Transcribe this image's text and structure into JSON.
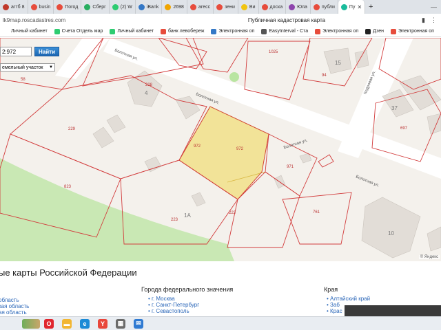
{
  "browser": {
    "tabs": [
      {
        "label": "агтб 8",
        "color": "#c0392b"
      },
      {
        "label": "busin",
        "color": "#e74c3c"
      },
      {
        "label": "Погод",
        "color": "#e74c3c"
      },
      {
        "label": "Сберг",
        "color": "#27ae60"
      },
      {
        "label": "(2) W",
        "color": "#2ecc71"
      },
      {
        "label": "iBank",
        "color": "#3478c6"
      },
      {
        "label": "2698",
        "color": "#f0a500"
      },
      {
        "label": "агесс",
        "color": "#e74c3c"
      },
      {
        "label": "зени",
        "color": "#e74c3c"
      },
      {
        "label": "Ви",
        "color": "#f1c40f"
      },
      {
        "label": "доска",
        "color": "#e74c3c"
      },
      {
        "label": "Юла",
        "color": "#8e44ad"
      },
      {
        "label": "публи",
        "color": "#e74c3c"
      },
      {
        "label": "Пу",
        "color": "#1abc9c",
        "active": true
      }
    ],
    "new_tab": "+",
    "url": "lk9map.roscadastres.com",
    "page_title": "Публичная кадастровая карта",
    "bookmarks": [
      {
        "label": "Личный кабинет",
        "color": "#ffffff"
      },
      {
        "label": "Счета Отдель мар",
        "color": "#2ecc71"
      },
      {
        "label": "Личный кабинет",
        "color": "#2ecc71"
      },
      {
        "label": "банк левобереж",
        "color": "#e74c3c"
      },
      {
        "label": "Электронная оп",
        "color": "#3478c6"
      },
      {
        "label": "EasyInterval - Ста",
        "color": "#555555"
      },
      {
        "label": "Электронная оп",
        "color": "#e74c3c"
      },
      {
        "label": "Дзен",
        "color": "#222222"
      },
      {
        "label": "Электронная оп",
        "color": "#e74c3c"
      }
    ]
  },
  "map": {
    "search_value": "2:972",
    "search_button": "Найти",
    "type_select": "емельный участок",
    "credit": "© Яндекс",
    "labels": {
      "parcel_main_a": "972",
      "parcel_main_b": "972",
      "p971": "971",
      "p229": "229",
      "p823": "823",
      "p223_a": "223",
      "p223_b": "223",
      "p761": "761",
      "p1025": "1025",
      "p94": "94",
      "p58": "58",
      "p228": "228",
      "b4": "4",
      "b1a": "1А",
      "b15": "15",
      "b37": "37",
      "b10": "10",
      "p697": "697",
      "street_bolotnaya_1": "Болотная ул.",
      "street_bolotnaya_2": "Болотная ул.",
      "street_bolotnaya_3": "Болотная ул.",
      "street_bolotnaya_4": "Болотная ул.",
      "street_kedrovaya": "Кедровая ул."
    }
  },
  "page": {
    "heading": "ые карты Российской Федерации",
    "col1": [
      "область",
      "кая область",
      "ая область"
    ],
    "col2_title": "Города федерального значения",
    "col2": [
      "г. Москва",
      "г. Санкт-Петербург",
      "г. Севастополь"
    ],
    "col3_title": "Края",
    "col3": [
      "Алтайский край",
      "Заб",
      "Крас"
    ]
  },
  "taskbar": {
    "icons": [
      {
        "name": "opera-icon",
        "color": "#e0262e",
        "glyph": "O"
      },
      {
        "name": "folder-icon",
        "color": "#f2b632",
        "glyph": "▬"
      },
      {
        "name": "edge-icon",
        "color": "#1b8ad6",
        "glyph": "e"
      },
      {
        "name": "yandex-browser-icon",
        "color": "#e8463b",
        "glyph": "Y"
      },
      {
        "name": "calculator-icon",
        "color": "#6a6a6a",
        "glyph": "▦"
      },
      {
        "name": "mail-icon",
        "color": "#2f7ad2",
        "glyph": "✉"
      }
    ]
  }
}
